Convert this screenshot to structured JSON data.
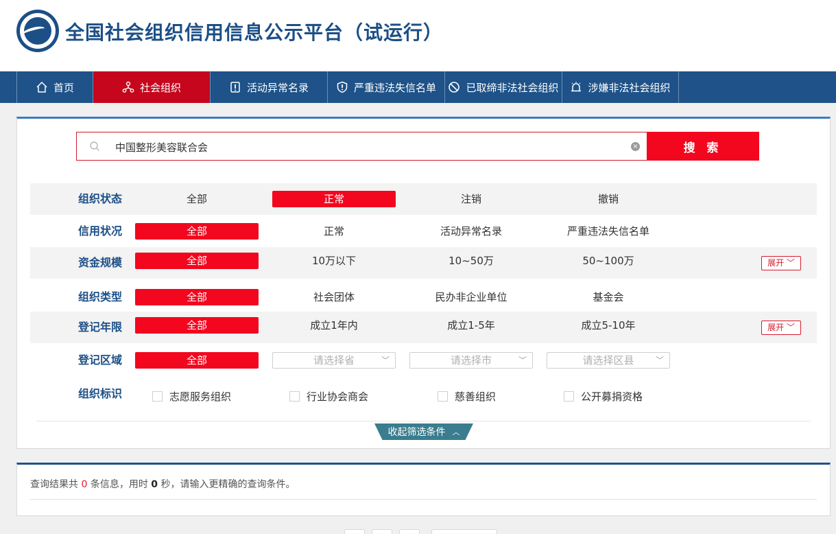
{
  "header": {
    "title": "全国社会组织信用信息公示平台（试运行）"
  },
  "nav": [
    {
      "label": "首页",
      "icon": "home-icon",
      "active": false
    },
    {
      "label": "社会组织",
      "icon": "org-network-icon",
      "active": true
    },
    {
      "label": "活动异常名录",
      "icon": "exclamation-doc-icon",
      "active": false
    },
    {
      "label": "严重违法失信名单",
      "icon": "shield-exclamation-icon",
      "active": false
    },
    {
      "label": "已取缔非法社会组织",
      "icon": "ban-icon",
      "active": false
    },
    {
      "label": "涉嫌非法社会组织",
      "icon": "alarm-icon",
      "active": false
    }
  ],
  "search": {
    "value": "中国整形美容联合会",
    "button_label": "搜 索"
  },
  "filters": {
    "status": {
      "label": "组织状态",
      "options": [
        "全部",
        "正常",
        "注销",
        "撤销"
      ],
      "selected": 1
    },
    "credit": {
      "label": "信用状况",
      "options": [
        "全部",
        "正常",
        "活动异常名录",
        "严重违法失信名单"
      ],
      "selected": 0
    },
    "capital": {
      "label": "资金规模",
      "options": [
        "全部",
        "10万以下",
        "10~50万",
        "50~100万"
      ],
      "selected": 0,
      "expand_label": "展开"
    },
    "type": {
      "label": "组织类型",
      "options": [
        "全部",
        "社会团体",
        "民办非企业单位",
        "基金会"
      ],
      "selected": 0
    },
    "years": {
      "label": "登记年限",
      "options": [
        "全部",
        "成立1年内",
        "成立1-5年",
        "成立5-10年"
      ],
      "selected": 0,
      "expand_label": "展开"
    },
    "region": {
      "label": "登记区域",
      "all_label": "全部",
      "province_placeholder": "请选择省",
      "city_placeholder": "请选择市",
      "district_placeholder": "请选择区县"
    },
    "tags": {
      "label": "组织标识",
      "options": [
        "志愿服务组织",
        "行业协会商会",
        "慈善组织",
        "公开募捐资格"
      ]
    }
  },
  "collapse_label": "收起筛选条件",
  "result": {
    "prefix": "查询结果共",
    "count": "0",
    "mid": "条信息，用时",
    "seconds": "0",
    "suffix": "秒，请输入更精确的查询条件。"
  },
  "colors": {
    "brand_blue": "#1e5288",
    "accent_red": "#f2071e",
    "active_nav": "#c5061d",
    "collapse_teal": "#3a7d8f"
  }
}
